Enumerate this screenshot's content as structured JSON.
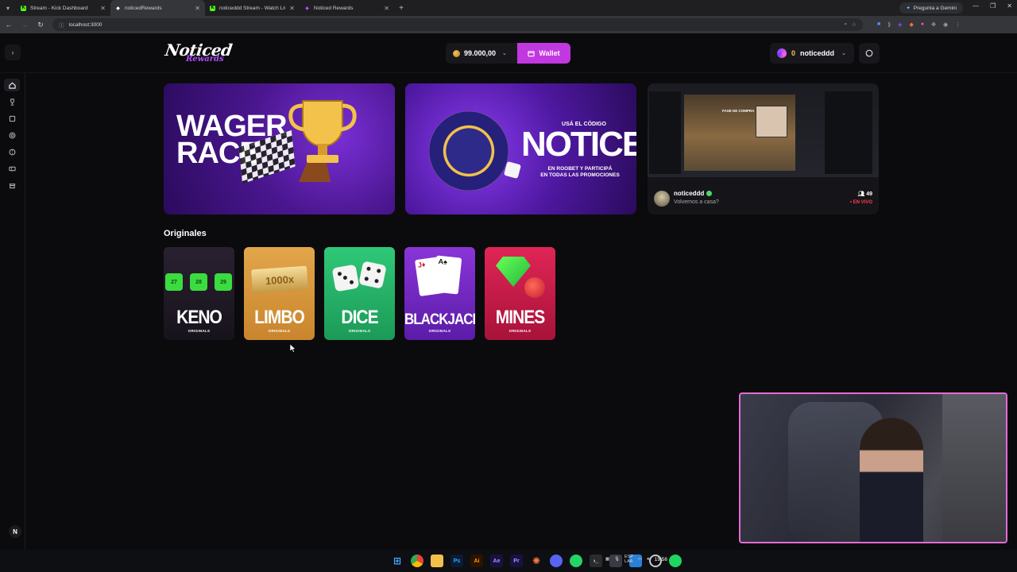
{
  "browser": {
    "tabs": [
      {
        "title": "Stream - Kick Dashboard",
        "fav": "K",
        "fav_color": "#53fc18",
        "active": false
      },
      {
        "title": "noticedRewards",
        "fav": "◆",
        "fav_color": "#ffffff",
        "active": true
      },
      {
        "title": "noticeddd Stream - Watch Live",
        "fav": "K",
        "fav_color": "#53fc18",
        "active": false
      },
      {
        "title": "Noticed Rewards",
        "fav": "◆",
        "fav_color": "#b14dff",
        "active": false
      }
    ],
    "gemini_label": "Pregunta a Gemini",
    "url": "localhost:3000"
  },
  "header": {
    "logo_main": "Noticed",
    "logo_sub": "Rewards",
    "balance": "99.000,00",
    "wallet_label": "Wallet",
    "user_level": "0",
    "username": "noticeddd"
  },
  "sidebar": {
    "items": [
      "home-icon",
      "trophy-icon",
      "square-icon",
      "target-icon",
      "compass-icon",
      "ticket-icon",
      "store-icon"
    ],
    "bottom_badge": "N"
  },
  "banners": {
    "wager": {
      "line1": "WAGER",
      "line2": "RACE"
    },
    "promo": {
      "pre": "USÁ EL CÓDIGO",
      "code": "NOTICED",
      "post1": "EN ROOBET Y PARTICIPÁ",
      "post2": "EN TODAS LAS PROMOCIONES"
    },
    "stream": {
      "scene_text": "FASE DE COMPRA",
      "name": "noticeddd",
      "title": "Volvemos a casa?",
      "viewers": "49",
      "live": "• EN VIVO"
    }
  },
  "originals": {
    "title": "Originales",
    "subtitle": "ORIGINALS",
    "keno_numbers": [
      "27",
      "28",
      "29"
    ],
    "limbo_multiplier": "1000x",
    "games": [
      {
        "name": "KENO",
        "cls": "g-keno"
      },
      {
        "name": "LIMBO",
        "cls": "g-limbo"
      },
      {
        "name": "DICE",
        "cls": "g-dice"
      },
      {
        "name": "BLACKJACK",
        "cls": "g-blackjack"
      },
      {
        "name": "MINES",
        "cls": "g-mines"
      }
    ]
  },
  "taskbar": {
    "lang_top": "ESP",
    "lang_bottom": "LAA",
    "time": "19:56"
  },
  "colors": {
    "accent": "#c238e0",
    "webcam_border": "#e46bd6",
    "coin": "#f3c55a"
  }
}
